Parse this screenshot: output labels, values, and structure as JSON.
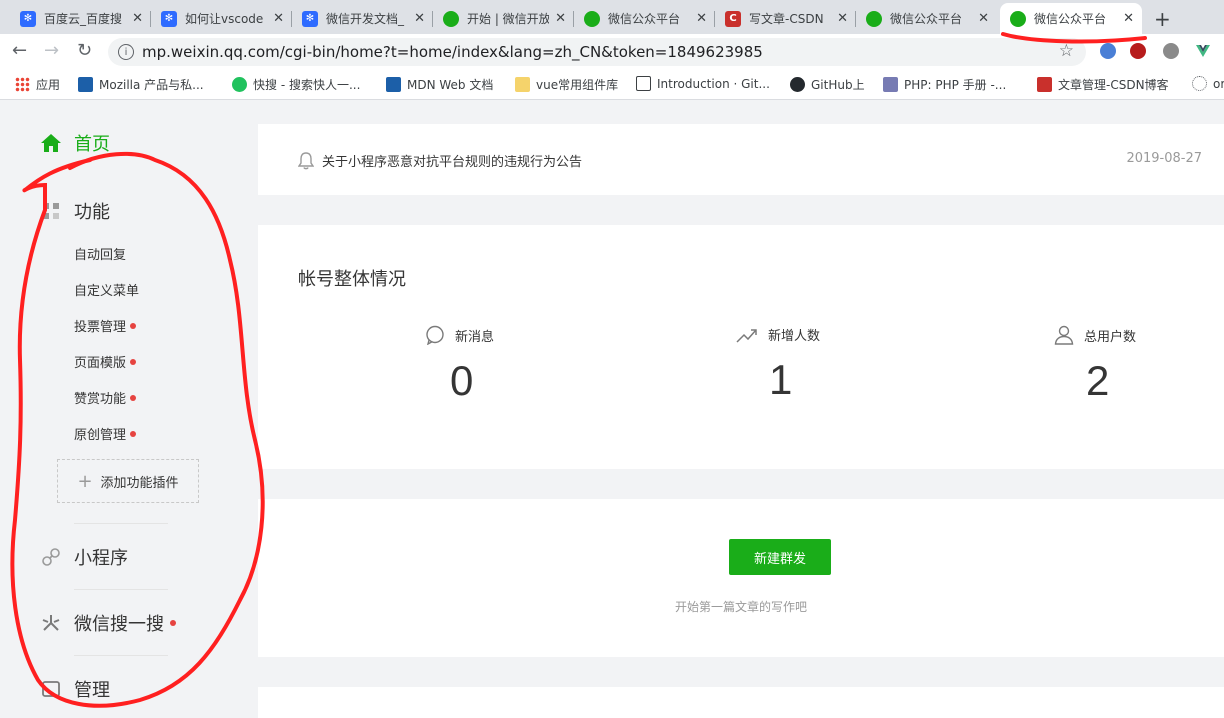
{
  "browser": {
    "tabs": [
      {
        "title": "百度云_百度搜",
        "icon": "baidu-paw-icon"
      },
      {
        "title": "如何让vscode",
        "icon": "baidu-paw-icon"
      },
      {
        "title": "微信开发文档_",
        "icon": "baidu-paw-icon"
      },
      {
        "title": "开始 | 微信开放",
        "icon": "wechat-icon"
      },
      {
        "title": "微信公众平台",
        "icon": "wechat-icon"
      },
      {
        "title": "写文章-CSDN",
        "icon": "csdn-icon"
      },
      {
        "title": "微信公众平台",
        "icon": "wechat-icon"
      },
      {
        "title": "微信公众平台",
        "icon": "wechat-icon",
        "active": true
      }
    ],
    "close_glyph": "✕",
    "new_tab_glyph": "+",
    "url": "mp.weixin.qq.com/cgi-bin/home?t=home/index&lang=zh_CN&token=1849623985",
    "bookmarks": [
      {
        "label": "应用",
        "icon": "apps-grid-icon"
      },
      {
        "label": "Mozilla 产品与私...",
        "icon": "mdn-icon"
      },
      {
        "label": "快搜 - 搜索快人一...",
        "icon": "kuaisou-icon"
      },
      {
        "label": "MDN Web 文档",
        "icon": "mdn-icon"
      },
      {
        "label": "vue常用组件库",
        "icon": "folder-icon"
      },
      {
        "label": "Introduction · Git...",
        "icon": "book-icon"
      },
      {
        "label": "GitHub上",
        "icon": "github-icon"
      },
      {
        "label": "PHP: PHP 手册 -...",
        "icon": "php-icon"
      },
      {
        "label": "文章管理-CSDN博客",
        "icon": "csdn-icon"
      },
      {
        "label": "or",
        "icon": "loading-icon"
      }
    ]
  },
  "sidebar": {
    "home": "首页",
    "function_section": "功能",
    "function_items": [
      {
        "label": "自动回复",
        "dot": false
      },
      {
        "label": "自定义菜单",
        "dot": false
      },
      {
        "label": "投票管理",
        "dot": true
      },
      {
        "label": "页面模版",
        "dot": true
      },
      {
        "label": "赞赏功能",
        "dot": true
      },
      {
        "label": "原创管理",
        "dot": true
      }
    ],
    "add_plugin": "添加功能插件",
    "mini_program": "小程序",
    "wechat_search": "微信搜一搜",
    "manage": "管理"
  },
  "notice": {
    "text": "关于小程序恶意对抗平台规则的违规行为公告",
    "date": "2019-08-27"
  },
  "overview": {
    "title": "帐号整体情况",
    "stats": [
      {
        "label": "新消息",
        "value": "0",
        "icon": "message-bubble-icon"
      },
      {
        "label": "新增人数",
        "value": "1",
        "icon": "trend-up-icon"
      },
      {
        "label": "总用户数",
        "value": "2",
        "icon": "user-icon"
      }
    ]
  },
  "compose": {
    "button": "新建群发",
    "hint": "开始第一篇文章的写作吧"
  },
  "colors": {
    "brand_green": "#1aad19",
    "badge_red": "#e64340",
    "annotation_red": "#ff2020"
  }
}
